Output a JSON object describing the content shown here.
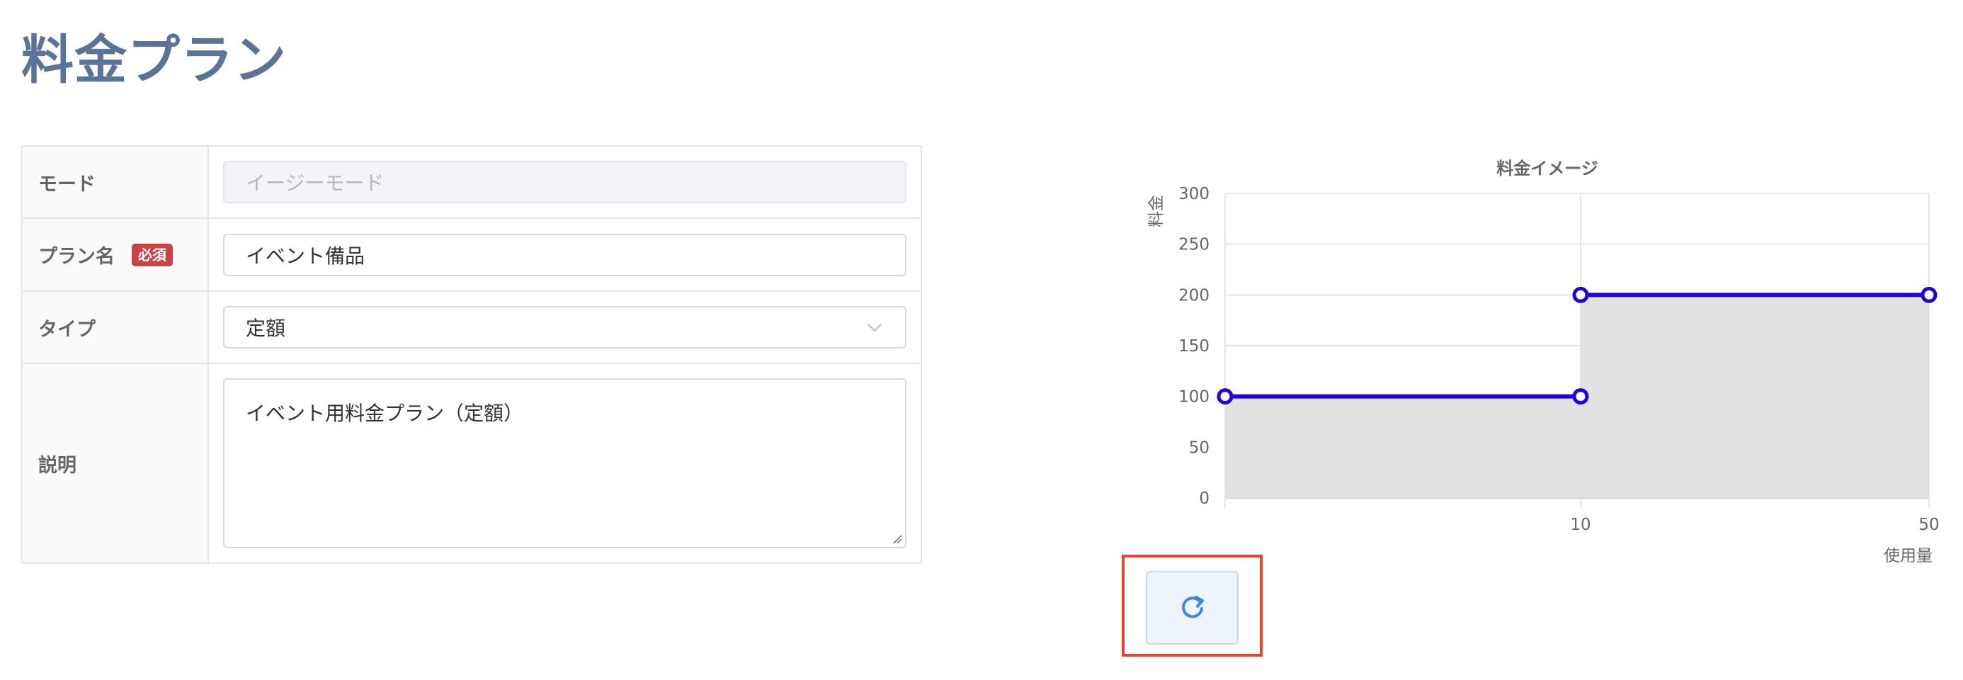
{
  "page": {
    "title": "料金プラン"
  },
  "form": {
    "mode": {
      "label": "モード",
      "placeholder": "イージーモード"
    },
    "plan_name": {
      "label": "プラン名",
      "required_badge": "必須",
      "value": "イベント備品"
    },
    "type": {
      "label": "タイプ",
      "value": "定額"
    },
    "description": {
      "label": "説明",
      "value": "イベント用料金プラン（定額）"
    }
  },
  "chart_data": {
    "type": "line",
    "title": "料金イメージ",
    "xlabel": "使用量",
    "ylabel": "料金",
    "x_ticks": [
      "10",
      "50"
    ],
    "y_ticks": [
      "300",
      "250",
      "200",
      "150",
      "100",
      "50",
      "0"
    ],
    "ylim": [
      0,
      300
    ],
    "series": [
      {
        "name": "",
        "points": [
          {
            "x": "0",
            "y": 100
          },
          {
            "x": "10",
            "y": 100
          },
          {
            "x": "10",
            "y": 200
          },
          {
            "x": "50",
            "y": 200
          }
        ],
        "color": "#2200dd",
        "fill": "#e2e2e2"
      }
    ]
  },
  "refresh_button": {
    "icon": "refresh-icon",
    "highlight_color": "#e5452d"
  }
}
